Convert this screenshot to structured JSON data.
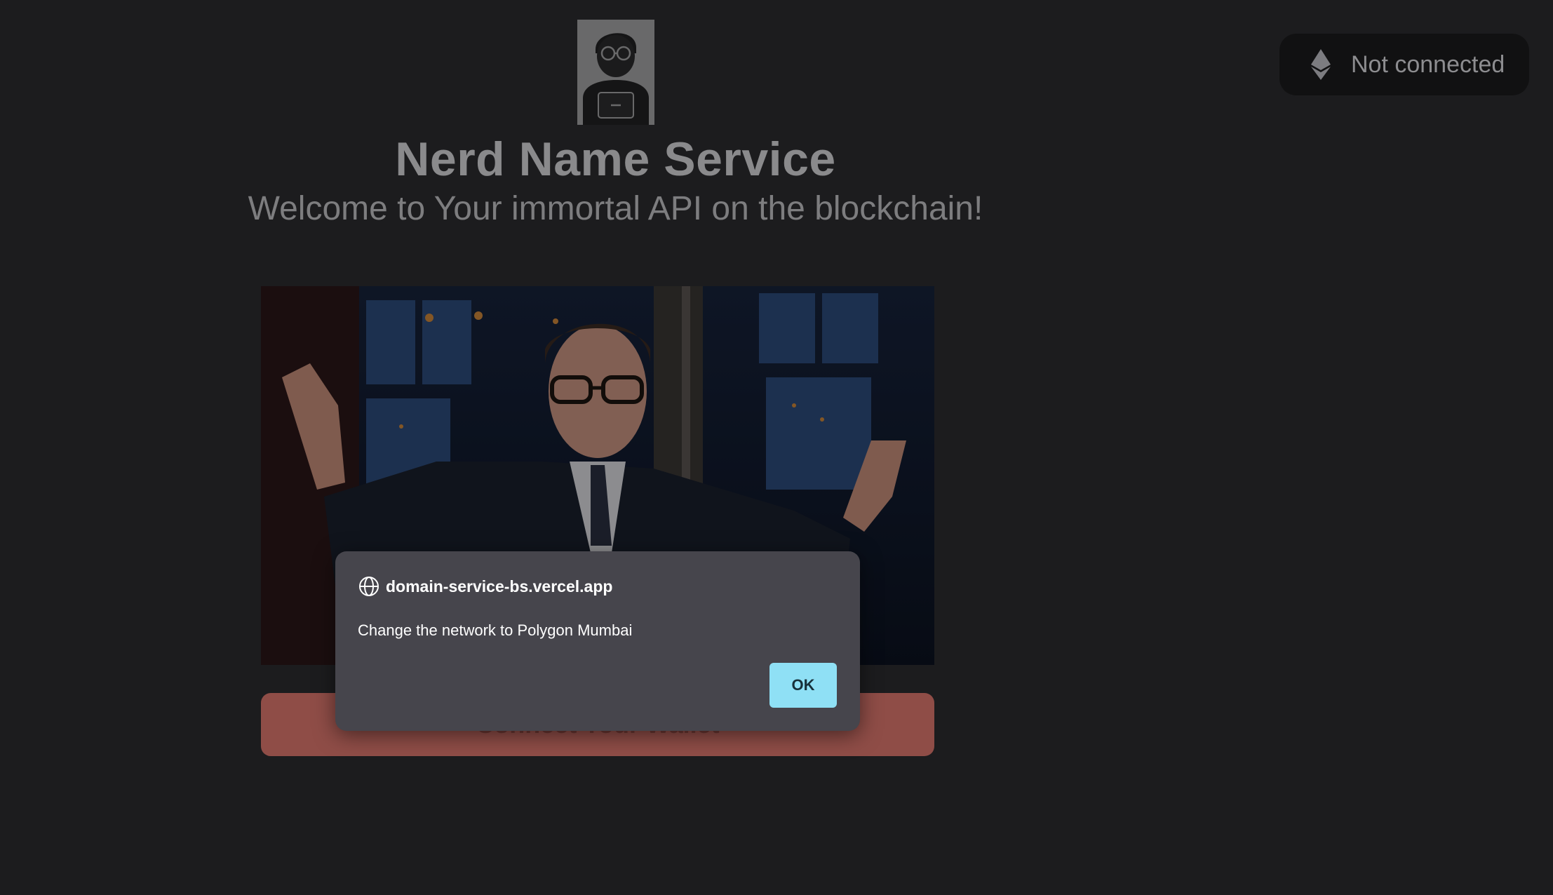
{
  "header": {
    "title": "Nerd Name Service",
    "subtitle": "Welcome to Your immortal API on the blockchain!"
  },
  "logo": {
    "icon": "nerd-avatar-icon"
  },
  "wallet": {
    "icon": "ethereum-icon",
    "status": "Not connected"
  },
  "hero": {
    "icon": "host-shrugging-gif"
  },
  "connect_button": {
    "label": "Connect Your Wallet"
  },
  "alert": {
    "origin_icon": "globe-icon",
    "origin": "domain-service-bs.vercel.app",
    "message": "Change the network to Polygon Mumbai",
    "ok_label": "OK"
  },
  "colors": {
    "background": "#1c1c1e",
    "dialog": "#46454c",
    "ok_button": "#8fe0f5",
    "connect_button": "#8f4d47"
  }
}
